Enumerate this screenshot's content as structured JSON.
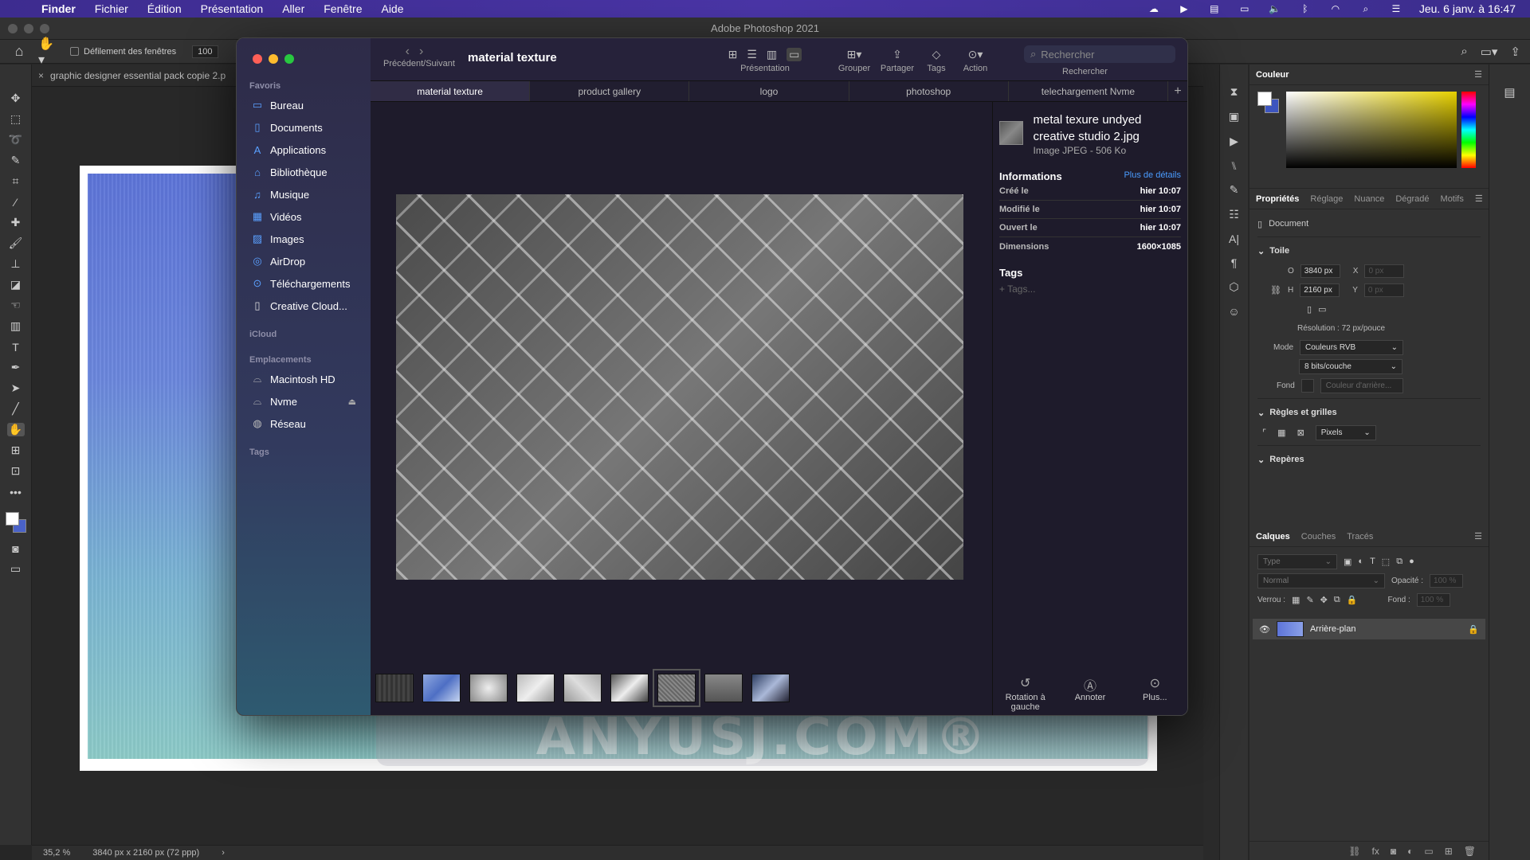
{
  "menubar": {
    "app": "Finder",
    "items": [
      "Fichier",
      "Édition",
      "Présentation",
      "Aller",
      "Fenêtre",
      "Aide"
    ],
    "datetime": "Jeu. 6 janv. à 16:47"
  },
  "photoshop": {
    "title": "Adobe Photoshop 2021",
    "options": {
      "scroll_all": "Défilement des fenêtres",
      "zoom": "100"
    },
    "doc_tab": "graphic designer essential pack copie 2.p",
    "status": {
      "zoom": "35,2 %",
      "size": "3840 px x 2160 px (72 ppp)"
    }
  },
  "panels": {
    "color_title": "Couleur",
    "props_tabs": [
      "Propriétés",
      "Réglage",
      "Nuance",
      "Dégradé",
      "Motifs"
    ],
    "document_label": "Document",
    "canvas": {
      "section": "Toile",
      "w_label": "O",
      "w_value": "3840 px",
      "h_label": "H",
      "h_value": "2160 px",
      "x_label": "X",
      "x_value": "0 px",
      "y_label": "Y",
      "y_value": "0 px",
      "resolution": "Résolution : 72 px/pouce",
      "mode_label": "Mode",
      "mode_value": "Couleurs RVB",
      "depth_value": "8 bits/couche",
      "bg_label": "Fond",
      "bg_value": "Couleur d'arrière..."
    },
    "rulers": {
      "section": "Règles et grilles",
      "unit": "Pixels"
    },
    "guides": {
      "section": "Repères"
    },
    "layers_tabs": [
      "Calques",
      "Couches",
      "Tracés"
    ],
    "layers": {
      "filter_placeholder": "Type",
      "blend": "Normal",
      "opacity_label": "Opacité :",
      "opacity_value": "100 %",
      "lock_label": "Verrou :",
      "fill_label": "Fond :",
      "fill_value": "100 %",
      "layer_name": "Arrière-plan"
    }
  },
  "finder": {
    "title": "material texture",
    "nav_label": "Précédent/Suivant",
    "toolbar": {
      "view": "Présentation",
      "group": "Grouper",
      "share": "Partager",
      "tags": "Tags",
      "action": "Action",
      "search_label": "Rechercher",
      "search_placeholder": "Rechercher"
    },
    "sidebar": {
      "favorites_label": "Favoris",
      "favorites": [
        "Bureau",
        "Documents",
        "Applications",
        "Bibliothèque",
        "Musique",
        "Vidéos",
        "Images",
        "AirDrop",
        "Téléchargements",
        "Creative Cloud..."
      ],
      "icloud_label": "iCloud",
      "locations_label": "Emplacements",
      "locations": [
        "Macintosh HD",
        "Nvme",
        "Réseau"
      ],
      "tags_label": "Tags"
    },
    "tabs": [
      "material texture",
      "product gallery",
      "logo",
      "photoshop",
      "telechargement Nvme"
    ],
    "preview": {
      "filename": "metal texure undyed creative studio 2.jpg",
      "filetype": "Image JPEG - 506 Ko",
      "info_title": "Informations",
      "more_details": "Plus de détails",
      "rows": [
        {
          "k": "Créé le",
          "v": "hier 10:07"
        },
        {
          "k": "Modifié le",
          "v": "hier 10:07"
        },
        {
          "k": "Ouvert le",
          "v": "hier 10:07"
        },
        {
          "k": "Dimensions",
          "v": "1600×1085"
        }
      ],
      "tags_title": "Tags",
      "tags_placeholder": "+ Tags...",
      "actions": [
        "Rotation à gauche",
        "Annoter",
        "Plus..."
      ]
    }
  },
  "watermark": "ANYUSJ.COM®"
}
